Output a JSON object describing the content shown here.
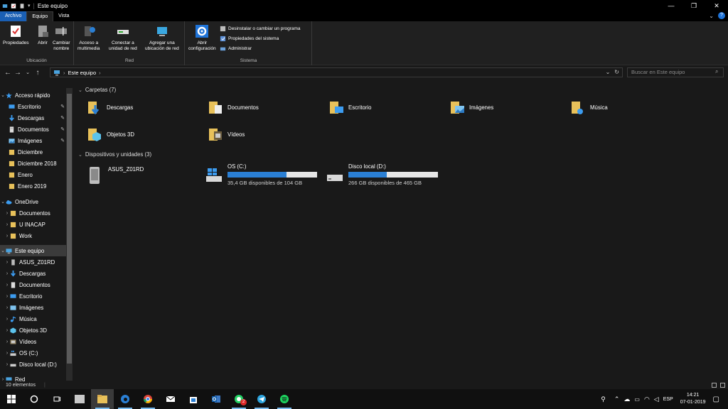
{
  "window": {
    "title": "Este equipo",
    "controls": {
      "minimize": "—",
      "maximize": "❐",
      "close": "✕"
    }
  },
  "tabs": {
    "file": "Archivo",
    "equipo": "Equipo",
    "vista": "Vista",
    "help": "?"
  },
  "ribbon": {
    "ubicacion": {
      "label": "Ubicación",
      "propiedades": "Propiedades",
      "abrir": "Abrir",
      "cambiar_l1": "Cambiar",
      "cambiar_l2": "nombre"
    },
    "red": {
      "label": "Red",
      "acceso_l1": "Acceso a",
      "acceso_l2": "multimedia",
      "conectar_l1": "Conectar a",
      "conectar_l2": "unidad de red",
      "agregar_l1": "Agregar una",
      "agregar_l2": "ubicación de red"
    },
    "sistema": {
      "label": "Sistema",
      "abrir_l1": "Abrir",
      "abrir_l2": "configuración",
      "desinstalar": "Desinstalar o cambiar un programa",
      "propiedades": "Propiedades del sistema",
      "administrar": "Administrar"
    }
  },
  "address": {
    "path": "Este equipo",
    "search_placeholder": "Buscar en Este equipo"
  },
  "nav": {
    "quick_access": "Acceso rápido",
    "quick_items": [
      "Escritorio",
      "Descargas",
      "Documentos",
      "Imágenes",
      "Diciembre",
      "Diciembre 2018",
      "Enero",
      "Enero 2019"
    ],
    "onedrive": "OneDrive",
    "onedrive_items": [
      "Documentos",
      "U INACAP",
      "Work"
    ],
    "this_pc": "Este equipo",
    "pc_items": [
      "ASUS_Z01RD",
      "Descargas",
      "Documentos",
      "Escritorio",
      "Imágenes",
      "Música",
      "Objetos 3D",
      "Vídeos",
      "OS (C:)",
      "Disco local (D:)"
    ],
    "red": "Red"
  },
  "content": {
    "folders_header": "Carpetas (7)",
    "folders": [
      "Descargas",
      "Documentos",
      "Escritorio",
      "Imágenes",
      "Música",
      "Objetos 3D",
      "Vídeos"
    ],
    "devices_header": "Dispositivos y unidades (3)",
    "devices": [
      {
        "name": "ASUS_Z01RD"
      },
      {
        "name": "OS (C:)",
        "free": "35,4 GB disponibles de 104 GB",
        "used_fraction": 0.66
      },
      {
        "name": "Disco local (D:)",
        "free": "266 GB disponibles de 465 GB",
        "used_fraction": 0.43
      }
    ]
  },
  "status": {
    "count": "10 elementos"
  },
  "taskbar": {
    "lang": "ESP",
    "time": "14:21",
    "date": "07-01-2019",
    "whatsapp_badge": "2"
  },
  "colors": {
    "accent": "#1a5fb4",
    "folder": "#e8c15a",
    "drive_bar": "#2a7fd4"
  }
}
